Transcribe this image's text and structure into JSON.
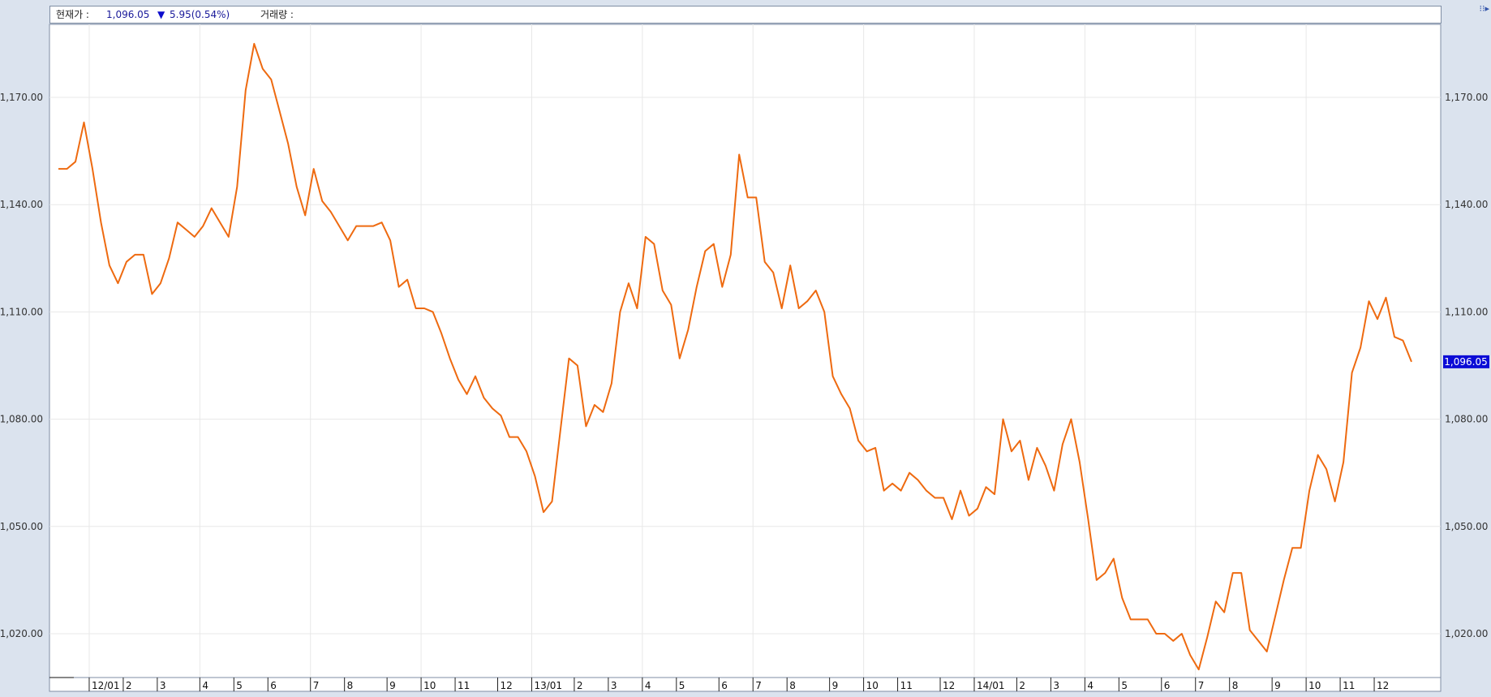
{
  "header": {
    "price_label": "현재가 :",
    "price_value": "1,096.05",
    "change_arrow": "▼",
    "change_value": "5.95(0.54%)",
    "volume_label": "거래량 :",
    "corner_icon": "chart-settings-icon"
  },
  "colors": {
    "line": "#ee6a10",
    "grid": "#e8e8e8",
    "background": "#ffffff",
    "frame": "#7f8ea4",
    "current_badge": "#0b0bd6"
  },
  "chart_data": {
    "type": "line",
    "title": "",
    "xlabel": "",
    "ylabel": "",
    "ylim": [
      1010,
      1190
    ],
    "yticks": [
      "1,170.00",
      "1,140.00",
      "1,110.00",
      "1,080.00",
      "1,050.00",
      "1,020.00"
    ],
    "ytick_values": [
      1170,
      1140,
      1110,
      1080,
      1050,
      1020
    ],
    "current_value_label": "1,096.05",
    "current_value": 1096.05,
    "xticks": [
      {
        "label": "12/01",
        "index": 4
      },
      {
        "label": "2",
        "index": 8
      },
      {
        "label": "3",
        "index": 12
      },
      {
        "label": "4",
        "index": 17
      },
      {
        "label": "5",
        "index": 21
      },
      {
        "label": "6",
        "index": 25
      },
      {
        "label": "7",
        "index": 30
      },
      {
        "label": "8",
        "index": 34
      },
      {
        "label": "9",
        "index": 39
      },
      {
        "label": "10",
        "index": 43
      },
      {
        "label": "11",
        "index": 47
      },
      {
        "label": "12",
        "index": 52
      },
      {
        "label": "13/01",
        "index": 56
      },
      {
        "label": "2",
        "index": 61
      },
      {
        "label": "3",
        "index": 65
      },
      {
        "label": "4",
        "index": 69
      },
      {
        "label": "5",
        "index": 73
      },
      {
        "label": "6",
        "index": 78
      },
      {
        "label": "7",
        "index": 82
      },
      {
        "label": "8",
        "index": 86
      },
      {
        "label": "9",
        "index": 91
      },
      {
        "label": "10",
        "index": 95
      },
      {
        "label": "11",
        "index": 99
      },
      {
        "label": "12",
        "index": 104
      },
      {
        "label": "14/01",
        "index": 108
      },
      {
        "label": "2",
        "index": 113
      },
      {
        "label": "3",
        "index": 117
      },
      {
        "label": "4",
        "index": 121
      },
      {
        "label": "5",
        "index": 125
      },
      {
        "label": "6",
        "index": 130
      },
      {
        "label": "7",
        "index": 134
      },
      {
        "label": "8",
        "index": 138
      },
      {
        "label": "9",
        "index": 143
      },
      {
        "label": "10",
        "index": 147
      },
      {
        "label": "11",
        "index": 151
      },
      {
        "label": "12",
        "index": 155
      }
    ],
    "series": [
      {
        "values": [
          1150,
          1150,
          1152,
          1163,
          1150,
          1135,
          1123,
          1118,
          1124,
          1126,
          1126,
          1115,
          1118,
          1125,
          1135,
          1133,
          1131,
          1134,
          1139,
          1135,
          1131,
          1145,
          1172,
          1185,
          1178,
          1175,
          1166,
          1157,
          1145,
          1137,
          1150,
          1141,
          1138,
          1134,
          1130,
          1134,
          1134,
          1134,
          1135,
          1130,
          1117,
          1119,
          1111,
          1111,
          1110,
          1104,
          1097,
          1091,
          1087,
          1092,
          1086,
          1083,
          1081,
          1075,
          1075,
          1071,
          1064,
          1054,
          1057,
          1077,
          1097,
          1095,
          1078,
          1084,
          1082,
          1090,
          1110,
          1118,
          1111,
          1131,
          1129,
          1116,
          1112,
          1097,
          1105,
          1117,
          1127,
          1129,
          1117,
          1126,
          1154,
          1142,
          1142,
          1124,
          1121,
          1111,
          1123,
          1111,
          1113,
          1116,
          1110,
          1092,
          1087,
          1083,
          1074,
          1071,
          1072,
          1060,
          1062,
          1060,
          1065,
          1063,
          1060,
          1058,
          1058,
          1052,
          1060,
          1053,
          1055,
          1061,
          1059,
          1080,
          1071,
          1074,
          1063,
          1072,
          1067,
          1060,
          1073,
          1080,
          1068,
          1052,
          1035,
          1037,
          1041,
          1030,
          1024,
          1024,
          1024,
          1020,
          1020,
          1018,
          1020,
          1014,
          1010,
          1019,
          1029,
          1026,
          1037,
          1037,
          1021,
          1018,
          1015,
          1025,
          1035,
          1044,
          1044,
          1060,
          1070,
          1066,
          1057,
          1068,
          1093,
          1100,
          1113,
          1108,
          1114,
          1103,
          1102,
          1096.05
        ]
      }
    ]
  }
}
